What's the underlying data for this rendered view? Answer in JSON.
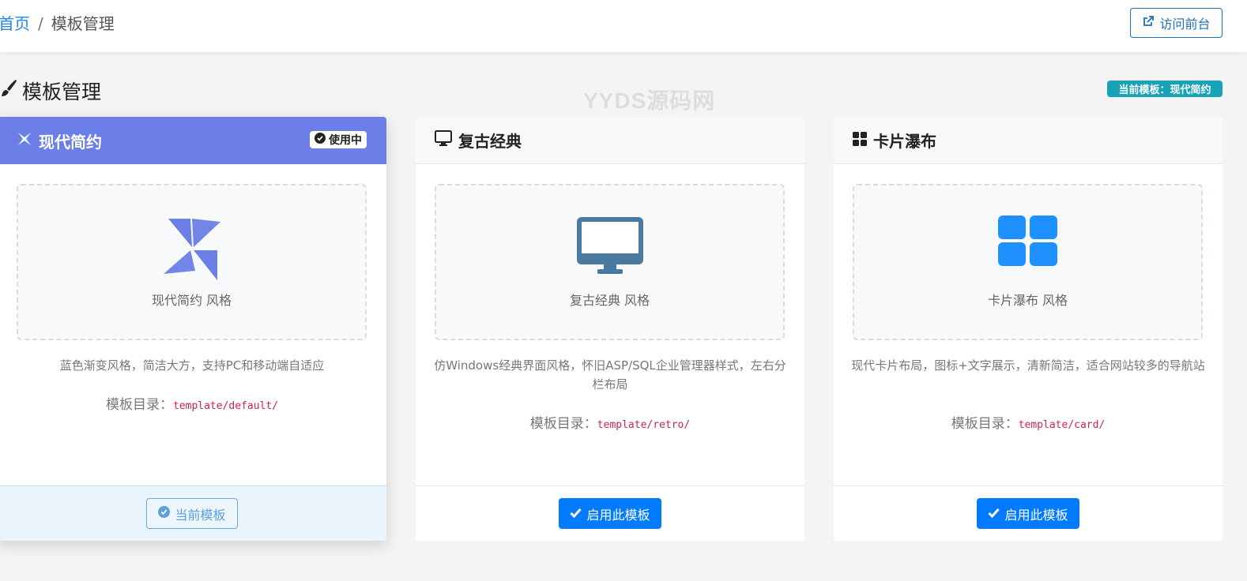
{
  "breadcrumb": {
    "home": "首页",
    "separator": "/",
    "current": "模板管理"
  },
  "header": {
    "visit_button": "访问前台"
  },
  "page": {
    "title": "模板管理",
    "watermark": "YYDS源码网",
    "current_badge": "当前模板：现代简约"
  },
  "templates": [
    {
      "name": "现代简约",
      "icon": "pinwheel-icon",
      "status_badge": "使用中",
      "preview_caption": "现代简约 风格",
      "description": "蓝色渐变风格，简洁大方，支持PC和移动端自适应",
      "dir_label": "模板目录：",
      "dir_path": "template/default/",
      "button": "当前模板",
      "accent": "#6c7fe6"
    },
    {
      "name": "复古经典",
      "icon": "desktop-icon",
      "preview_caption": "复古经典 风格",
      "description": "仿Windows经典界面风格，怀旧ASP/SQL企业管理器样式，左右分栏布局",
      "dir_label": "模板目录：",
      "dir_path": "template/retro/",
      "button": "启用此模板",
      "accent": "#4a7aa0"
    },
    {
      "name": "卡片瀑布",
      "icon": "grid-icon",
      "preview_caption": "卡片瀑布 风格",
      "description": "现代卡片布局，图标+文字展示，清新简洁，适合网站较多的导航站",
      "dir_label": "模板目录：",
      "dir_path": "template/card/",
      "button": "启用此模板",
      "accent": "#1e90ff"
    }
  ]
}
